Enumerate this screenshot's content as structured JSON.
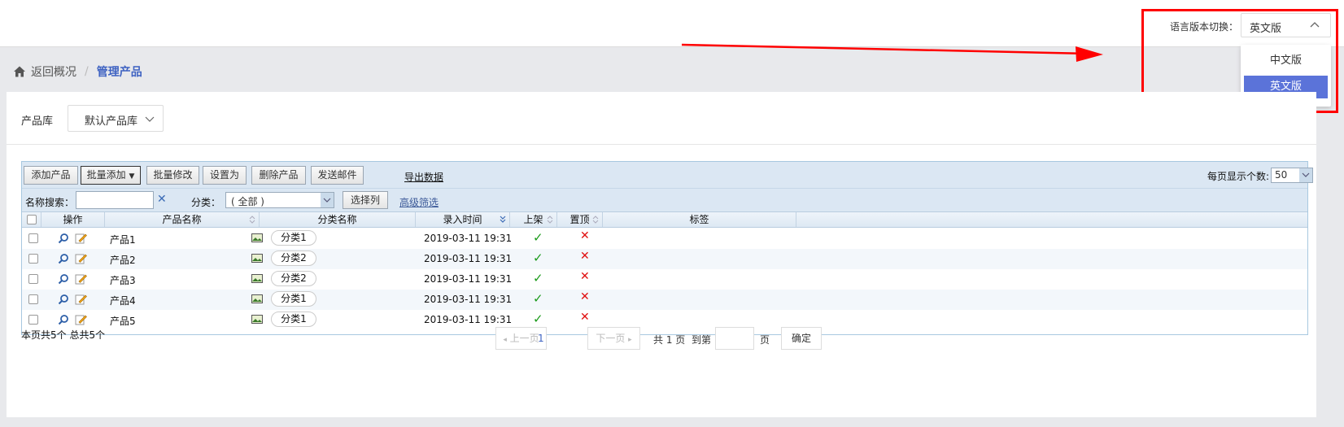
{
  "topbar": {
    "lang_label": "语言版本切换：",
    "lang_value": "英文版",
    "lang_options": [
      "中文版",
      "英文版"
    ]
  },
  "breadcrumb": {
    "back": "返回概况",
    "separator": "/",
    "current": "管理产品"
  },
  "library": {
    "label": "产品库",
    "value": "默认产品库"
  },
  "toolbar": {
    "add": "添加产品",
    "batch_add": "批量添加",
    "batch_edit": "批量修改",
    "set_as": "设置为",
    "delete": "删除产品",
    "send_mail": "发送邮件",
    "export": "导出数据",
    "per_page_label": "每页显示个数:",
    "per_page_value": "50"
  },
  "filter": {
    "search_label": "名称搜索：",
    "search_value": "",
    "clear": "✕",
    "category_label": "分类：",
    "category_value": "( 全部 )",
    "choose_columns": "选择列",
    "advanced": "高级筛选"
  },
  "table": {
    "headers": {
      "ops": "操作",
      "name": "产品名称",
      "category": "分类名称",
      "time": "录入时间",
      "listed": "上架",
      "pinned": "置顶",
      "tags": "标签"
    },
    "rows": [
      {
        "name": "产品1",
        "category": "分类1",
        "time": "2019-03-11 19:31",
        "listed": true,
        "pinned": false
      },
      {
        "name": "产品2",
        "category": "分类2",
        "time": "2019-03-11 19:31",
        "listed": true,
        "pinned": false
      },
      {
        "name": "产品3",
        "category": "分类2",
        "time": "2019-03-11 19:31",
        "listed": true,
        "pinned": false
      },
      {
        "name": "产品4",
        "category": "分类1",
        "time": "2019-03-11 19:31",
        "listed": true,
        "pinned": false
      },
      {
        "name": "产品5",
        "category": "分类1",
        "time": "2019-03-11 19:31",
        "listed": true,
        "pinned": false
      }
    ]
  },
  "footer": {
    "summary": "本页共5个 总共5个",
    "prev": "上一页",
    "page": "1",
    "next": "下一页",
    "total": "共 1 页",
    "goto": "到第",
    "page_unit": "页",
    "ok": "确定"
  },
  "colors": {
    "accent": "#5b73d9",
    "link": "#3f63c2",
    "annotation": "#ff0000",
    "check": "#1a9a1a",
    "cross": "#e01010"
  },
  "icons": {
    "home": "home-icon",
    "chevron": "chevron-up-icon",
    "view": "search-icon",
    "edit": "edit-icon",
    "image": "image-icon",
    "check": "check-icon",
    "cross": "cross-icon"
  }
}
